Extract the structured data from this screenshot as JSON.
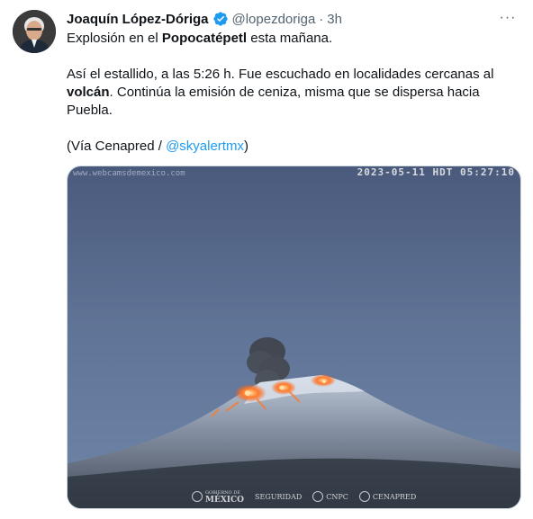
{
  "author": {
    "name": "Joaquín López-Dóriga",
    "handle": "@lopezdoriga",
    "separator": "·",
    "time": "3h",
    "verified_color": "#1d9bf0"
  },
  "more_menu": {
    "glyph": "···"
  },
  "tweet": {
    "line1_prefix": "Explosión en el ",
    "line1_bold": "Popocatépetl",
    "line1_suffix": " esta mañana.",
    "line2_prefix": "Así el estallido, a las 5:26 h. Fue escuchado en localidades cercanas al ",
    "line2_bold": "volcán",
    "line2_suffix": ". Continúa la emisión de ceniza, misma que se dispersa hacia Puebla.",
    "line3_prefix": "(Vía Cenapred / ",
    "line3_link": "@skyalertmx",
    "line3_suffix": ")"
  },
  "media": {
    "watermark_site": "www.webcamsdemexico.com",
    "timestamp_overlay": "2023-05-11 HDT 05:27:10",
    "logos": {
      "gobierno_top": "GOBIERNO DE",
      "gobierno_main": "MÉXICO",
      "seguridad": "SEGURIDAD",
      "cnpc": "CNPC",
      "cenapred": "CENAPRED"
    }
  },
  "colors": {
    "link": "#1d9bf0",
    "text": "#0f1419",
    "secondary": "#536471",
    "border": "#cfd9de"
  }
}
